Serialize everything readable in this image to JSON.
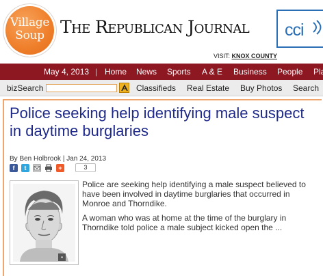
{
  "header": {
    "logo_line1": "Village",
    "logo_line2": "Soup",
    "title": "The Republican Journal",
    "partner_logo": "cci",
    "visit_label": "VISIT:",
    "visit_link": "KNOX COUNTY"
  },
  "nav": {
    "date": "May 4, 2013",
    "separator": "|",
    "items": [
      "Home",
      "News",
      "Sports",
      "A & E",
      "Business",
      "People",
      "Pla"
    ]
  },
  "subnav": {
    "bizsearch_label": "bizSearch",
    "bizsearch_value": "",
    "items": [
      "Classifieds",
      "Real Estate",
      "Buy Photos",
      "Search"
    ]
  },
  "article": {
    "headline": "Police seeking help identifying male suspect in daytime burglaries",
    "byline": "By Ben Holbrook | Jan 24, 2013",
    "share_count": "3",
    "paragraphs": [
      "Police are seeking help identifying a male suspect believed to have been involved in daytime burglaries that occurred in Monroe and Thorndike.",
      "A woman who was at home at the time of the burglary in Thorndike told police a male subject kicked open the ..."
    ]
  },
  "icons": {
    "share": [
      "facebook-icon",
      "twitter-icon",
      "email-icon",
      "print-icon",
      "add-icon"
    ],
    "expand": "expand-icon"
  },
  "colors": {
    "brand_red": "#8d1822",
    "logo_orange": "#ef7f2b",
    "headline_blue": "#1f2a8a",
    "article_border": "#f0a56d",
    "cci_blue": "#2a6fb6"
  }
}
